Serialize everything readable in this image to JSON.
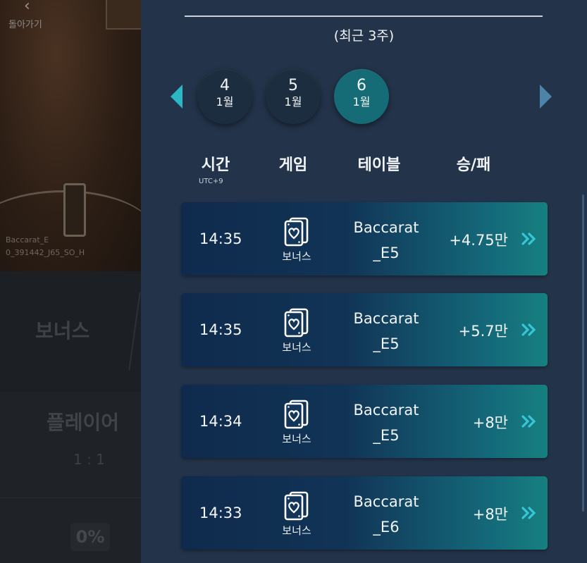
{
  "background": {
    "back_label": "돌아가기",
    "table_name_line1": "Baccarat_E",
    "table_name_line2": "0_391442_J65_SO_H",
    "game_label": "보너스",
    "player_label": "플레이어",
    "ratio": "1 : 1",
    "percent": "0%"
  },
  "header": {
    "subtitle": "(최근 3주)"
  },
  "date_selector": {
    "dates": [
      {
        "day": "4",
        "month": "1월",
        "active": false
      },
      {
        "day": "5",
        "month": "1월",
        "active": false
      },
      {
        "day": "6",
        "month": "1월",
        "active": true
      }
    ]
  },
  "columns": {
    "time": "시간",
    "time_sub": "UTC+9",
    "game": "게임",
    "table": "테이블",
    "result": "승/패"
  },
  "rows": [
    {
      "time": "14:35",
      "game": "보너스",
      "table_line1": "Baccarat",
      "table_line2": "_E5",
      "result": "+4.75만"
    },
    {
      "time": "14:35",
      "game": "보너스",
      "table_line1": "Baccarat",
      "table_line2": "_E5",
      "result": "+5.7만"
    },
    {
      "time": "14:34",
      "game": "보너스",
      "table_line1": "Baccarat",
      "table_line2": "_E5",
      "result": "+8만"
    },
    {
      "time": "14:33",
      "game": "보너스",
      "table_line1": "Baccarat",
      "table_line2": "_E6",
      "result": "+8만"
    }
  ],
  "icons": {
    "game_icon": "bonus-card-heart-icon",
    "row_arrow": "double-chevron-right-icon",
    "nav_prev": "triangle-left-icon",
    "nav_next": "triangle-right-icon"
  },
  "colors": {
    "panel_bg": "#233349",
    "active_date": "#166c76",
    "accent_cyan": "#2bb7c4"
  }
}
